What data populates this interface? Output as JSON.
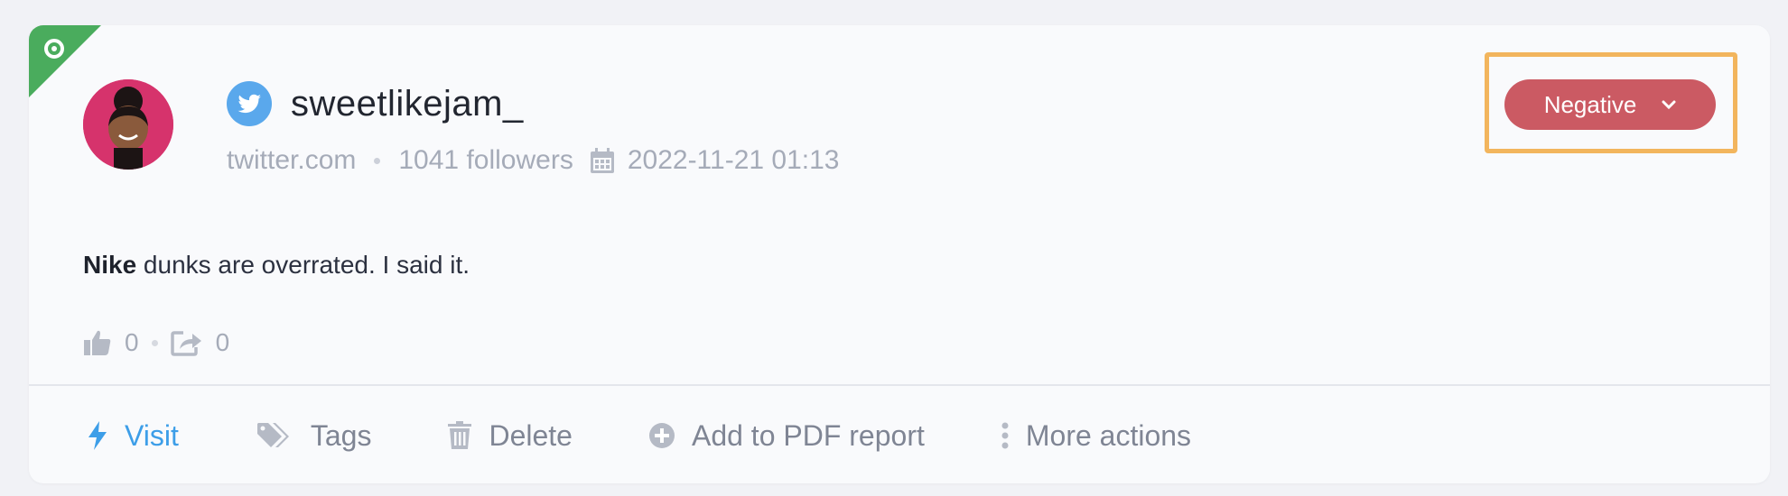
{
  "post": {
    "username": "sweetlikejam_",
    "network_icon": "twitter-bird-icon",
    "source": "twitter.com",
    "followers": "1041 followers",
    "date": "2022-11-21 01:13",
    "text_keyword": "Nike",
    "text_rest": " dunks are overrated. I said it.",
    "likes": "0",
    "shares": "0"
  },
  "sentiment": {
    "label": "Negative",
    "color": "#cb5a63",
    "highlight_color": "#f2b55d"
  },
  "actions": {
    "visit": "Visit",
    "tags": "Tags",
    "delete": "Delete",
    "add_pdf": "Add to PDF report",
    "more": "More actions"
  },
  "colors": {
    "accent_blue": "#3d9ee8",
    "ribbon_green": "#4aac5d",
    "twitter_blue": "#5aa8ec"
  }
}
